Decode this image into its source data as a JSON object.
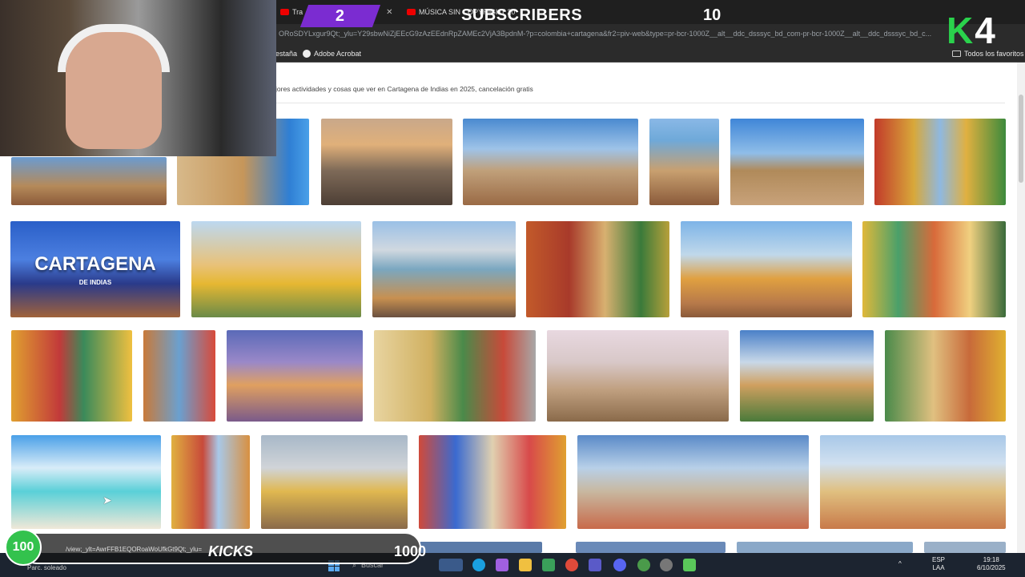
{
  "browser": {
    "tabs": [
      {
        "label": "Tra",
        "icon": "youtube-icon"
      },
      {
        "label": "MÚSICA SIN COPYRIGHT 20",
        "icon": "youtube-icon"
      }
    ],
    "url": "ORoSDYLxgur9Qt;_ylu=Y29sbwNiZjEEcG9zAzEEdnRpZAMEc2VjA3BpdnM-?p=colombia+cartagena&fr2=piv-web&type=pr-bcr-1000Z__alt__ddc_dsssyc_bd_com-pr-bcr-1000Z__alt__ddc_dsssyc_bd_c...",
    "bookmarks": [
      {
        "label": "estaña"
      },
      {
        "label": "Adobe Acrobat"
      }
    ],
    "all_bookmarks_label": "Todos los favoritos"
  },
  "content": {
    "description": "jores actividades y cosas que ver en Cartagena de Indias en 2025, cancelación gratis",
    "overlay_title": "CARTAGENA",
    "overlay_subtitle": "DE INDIAS"
  },
  "stream": {
    "sub_count": "2",
    "sub_title": "SUBSCRIBERS",
    "sub_goal": "10",
    "logo_k": "K",
    "logo_num": "4",
    "kicks_current": "100",
    "kicks_label": "KICKS",
    "kicks_goal": "1000",
    "status_url": "/view;_ylt=AwrFFB1EQORoaWoUfkGt9Qt;_ylu=c2V"
  },
  "taskbar": {
    "weather": "Parc. soleado",
    "search_placeholder": "Buscar",
    "lang_top": "ESP",
    "lang_bottom": "LAA",
    "time": "19:18",
    "date": "6/10/2025"
  },
  "colors": {
    "sub_banner": "#7b2cd1",
    "kick_green": "#33c24d",
    "logo_green": "#2ad24c"
  }
}
